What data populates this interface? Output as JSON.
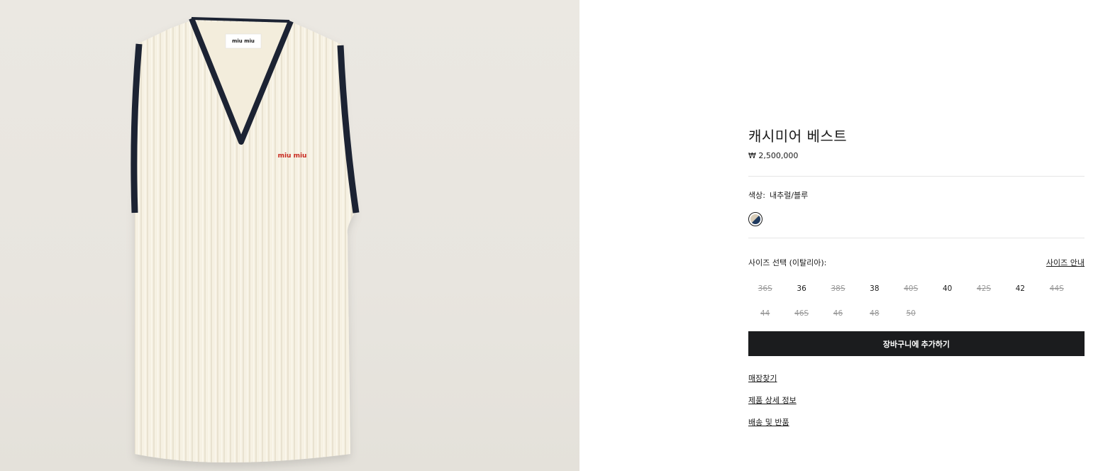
{
  "product": {
    "title": "캐시미어 베스트",
    "price": "₩ 2,500,000",
    "image_alt_label": "miu miu",
    "neck_label": "miu miu"
  },
  "color": {
    "label": "색상:",
    "value": "내추럴/블루",
    "swatch_colors": [
      "#d9cdb8",
      "#1f3a5f"
    ]
  },
  "size": {
    "label": "사이즈 선택 (이탈리아):",
    "guide_label": "사이즈 안내",
    "options": [
      {
        "label": "36S",
        "available": false
      },
      {
        "label": "36",
        "available": true
      },
      {
        "label": "38S",
        "available": false
      },
      {
        "label": "38",
        "available": true
      },
      {
        "label": "40S",
        "available": false
      },
      {
        "label": "40",
        "available": true
      },
      {
        "label": "42S",
        "available": false
      },
      {
        "label": "42",
        "available": true
      },
      {
        "label": "44S",
        "available": false
      },
      {
        "label": "44",
        "available": false
      },
      {
        "label": "46S",
        "available": false
      },
      {
        "label": "46",
        "available": false
      },
      {
        "label": "48",
        "available": false
      },
      {
        "label": "50",
        "available": false
      }
    ]
  },
  "cart_button_label": "장바구니에 추가하기",
  "links": {
    "store_finder": "매장찾기",
    "product_details": "제품 상세 정보",
    "shipping_returns": "배송 및 반품"
  },
  "colors": {
    "background": "#e9e6e0",
    "vest_body": "#f6f1e3",
    "trim": "#1c2333",
    "logo_red": "#c8281e",
    "button": "#1b1c1e"
  }
}
